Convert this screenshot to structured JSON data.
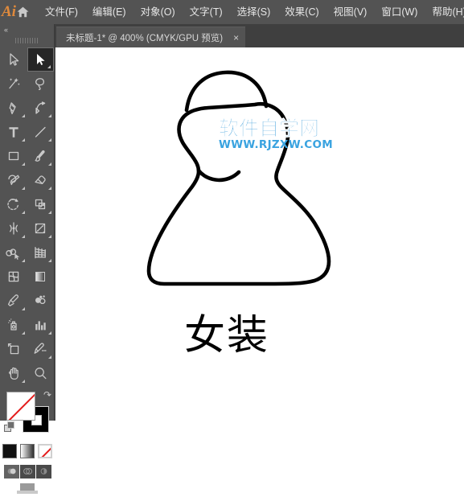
{
  "app": {
    "logo_text": "Ai",
    "home_icon": "home-icon"
  },
  "menubar": {
    "items": [
      {
        "label": "文件(F)",
        "name": "menu-file"
      },
      {
        "label": "编辑(E)",
        "name": "menu-edit"
      },
      {
        "label": "对象(O)",
        "name": "menu-object"
      },
      {
        "label": "文字(T)",
        "name": "menu-type"
      },
      {
        "label": "选择(S)",
        "name": "menu-select"
      },
      {
        "label": "效果(C)",
        "name": "menu-effect"
      },
      {
        "label": "视图(V)",
        "name": "menu-view"
      },
      {
        "label": "窗口(W)",
        "name": "menu-window"
      },
      {
        "label": "帮助(H)",
        "name": "menu-help"
      }
    ]
  },
  "document_tab": {
    "title": "未标题-1* @ 400% (CMYK/GPU 预览)",
    "close_label": "×",
    "zoom": "400%",
    "color_mode": "CMYK",
    "preview_mode": "GPU 预览",
    "modified": true
  },
  "toolpanel": {
    "collapse_label": "«",
    "tools": [
      {
        "name": "selection-tool",
        "title": "选择工具",
        "active": false,
        "flyout": false
      },
      {
        "name": "direct-selection-tool",
        "title": "直接选择工具",
        "active": true,
        "flyout": true
      },
      {
        "name": "magic-wand-tool",
        "title": "魔棒工具",
        "active": false,
        "flyout": false
      },
      {
        "name": "lasso-tool",
        "title": "套索工具",
        "active": false,
        "flyout": false
      },
      {
        "name": "pen-tool",
        "title": "钢笔工具",
        "active": false,
        "flyout": true
      },
      {
        "name": "curvature-tool",
        "title": "曲率工具",
        "active": false,
        "flyout": true
      },
      {
        "name": "type-tool",
        "title": "文字工具",
        "active": false,
        "flyout": true
      },
      {
        "name": "line-segment-tool",
        "title": "直线段工具",
        "active": false,
        "flyout": true
      },
      {
        "name": "rectangle-tool",
        "title": "矩形工具",
        "active": false,
        "flyout": true
      },
      {
        "name": "paintbrush-tool",
        "title": "画笔工具",
        "active": false,
        "flyout": true
      },
      {
        "name": "shaper-pencil-tool",
        "title": "Shaper 工具",
        "active": false,
        "flyout": true
      },
      {
        "name": "eraser-tool",
        "title": "橡皮擦工具",
        "active": false,
        "flyout": true
      },
      {
        "name": "rotate-tool",
        "title": "旋转工具",
        "active": false,
        "flyout": true
      },
      {
        "name": "scale-tool",
        "title": "比例缩放工具",
        "active": false,
        "flyout": true
      },
      {
        "name": "width-tool",
        "title": "宽度工具",
        "active": false,
        "flyout": true
      },
      {
        "name": "free-transform-tool",
        "title": "自由变换工具",
        "active": false,
        "flyout": true
      },
      {
        "name": "shape-builder-tool",
        "title": "形状生成器工具",
        "active": false,
        "flyout": true
      },
      {
        "name": "perspective-grid-tool",
        "title": "透视网格工具",
        "active": false,
        "flyout": true
      },
      {
        "name": "mesh-tool",
        "title": "网格工具",
        "active": false,
        "flyout": false
      },
      {
        "name": "gradient-tool",
        "title": "渐变工具",
        "active": false,
        "flyout": false
      },
      {
        "name": "eyedropper-tool",
        "title": "吸管工具",
        "active": false,
        "flyout": true
      },
      {
        "name": "blend-tool",
        "title": "混合工具",
        "active": false,
        "flyout": false
      },
      {
        "name": "symbol-sprayer-tool",
        "title": "符号喷枪工具",
        "active": false,
        "flyout": true
      },
      {
        "name": "column-graph-tool",
        "title": "柱形图工具",
        "active": false,
        "flyout": true
      },
      {
        "name": "artboard-tool",
        "title": "画板工具",
        "active": false,
        "flyout": false
      },
      {
        "name": "slice-tool",
        "title": "切片工具",
        "active": false,
        "flyout": true
      },
      {
        "name": "hand-tool",
        "title": "抓手工具",
        "active": false,
        "flyout": true
      },
      {
        "name": "zoom-tool",
        "title": "缩放工具",
        "active": false,
        "flyout": false
      }
    ],
    "color_controls": {
      "fill": {
        "name": "fill-swatch",
        "value": "none",
        "color": "#ffffff"
      },
      "stroke": {
        "name": "stroke-swatch",
        "value": "black",
        "color": "#000000"
      },
      "swap_icon": "swap-fill-stroke-icon",
      "default_icon": "default-fill-stroke-icon"
    },
    "paint_modes": [
      {
        "name": "color-mode-solid",
        "label": "颜色",
        "selected": false
      },
      {
        "name": "color-mode-gradient",
        "label": "渐变",
        "selected": false
      },
      {
        "name": "color-mode-none",
        "label": "无",
        "selected": true
      }
    ],
    "draw_modes": [
      {
        "name": "draw-normal-mode",
        "label": "正常绘图",
        "active": true
      },
      {
        "name": "draw-behind-mode",
        "label": "背面绘图",
        "active": false
      },
      {
        "name": "draw-inside-mode",
        "label": "内部绘图",
        "active": false
      }
    ],
    "screen_mode": {
      "name": "change-screen-mode",
      "label": "更改屏幕模式"
    }
  },
  "canvas": {
    "background": "#ffffff",
    "artwork": {
      "name": "dress-outline-drawing",
      "stroke_color": "#000000",
      "fill": "none"
    },
    "caption": "女装",
    "watermark": {
      "main": "软件自学网",
      "sub": "WWW.RJZXW.COM",
      "color": "#1f8fd4"
    }
  }
}
